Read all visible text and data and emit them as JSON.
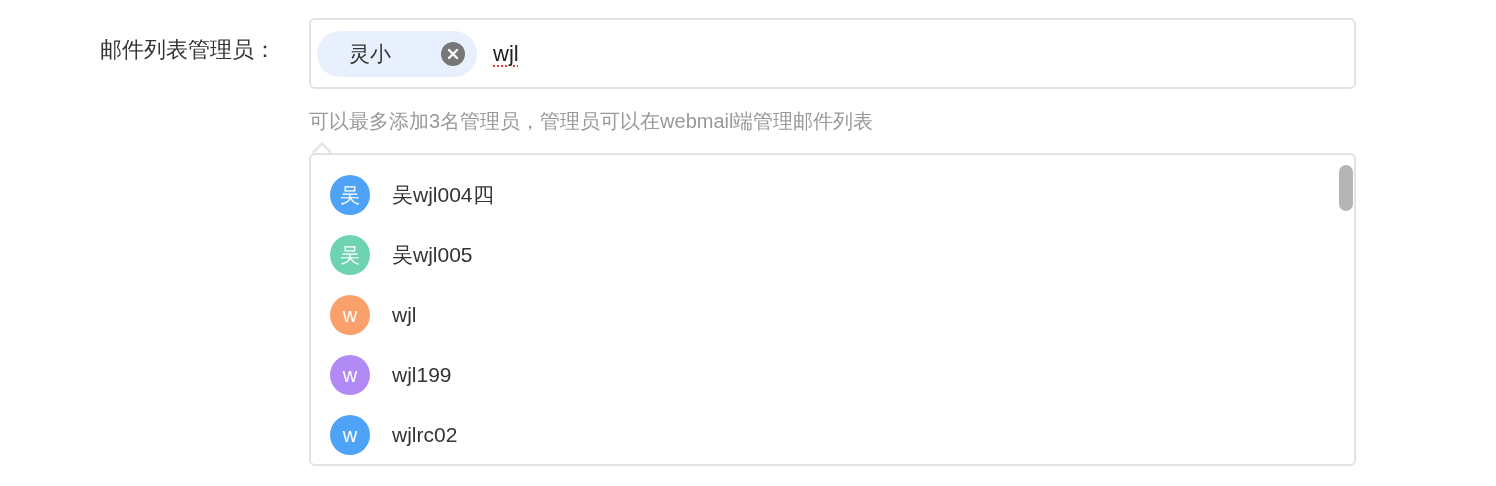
{
  "field": {
    "label": "邮件列表管理员：",
    "chips": [
      {
        "label": "灵小"
      }
    ],
    "value": "wjl",
    "hint": "可以最多添加3名管理员，管理员可以在webmail端管理邮件列表"
  },
  "suggestions": [
    {
      "avatar": "吴",
      "name": "吴wjl004四",
      "color": "#4fa3f7"
    },
    {
      "avatar": "吴",
      "name": "吴wjl005",
      "color": "#6dd3b0"
    },
    {
      "avatar": "w",
      "name": "wjl",
      "color": "#f9a06b"
    },
    {
      "avatar": "w",
      "name": "wjl199",
      "color": "#b18af5"
    },
    {
      "avatar": "w",
      "name": "wjlrc02",
      "color": "#4fa3f7"
    }
  ]
}
